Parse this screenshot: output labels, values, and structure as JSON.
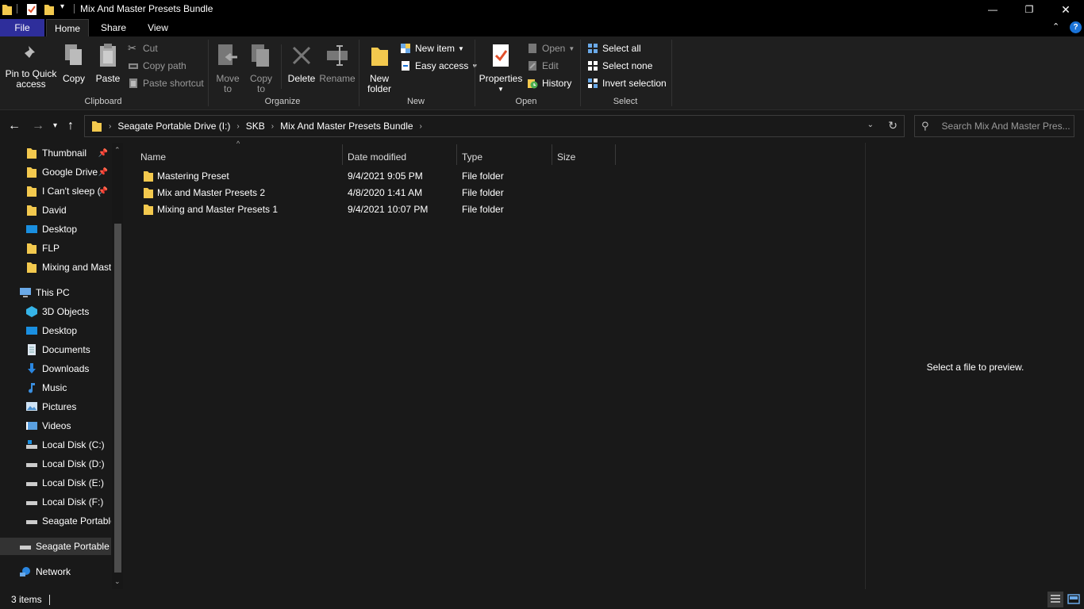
{
  "window": {
    "title": "Mix And Master Presets Bundle",
    "minimize": "—",
    "maximize": "❐",
    "close": "✕"
  },
  "tabs": [
    "File",
    "Home",
    "Share",
    "View"
  ],
  "ribbon": {
    "clipboard": {
      "label": "Clipboard",
      "pin": "Pin to Quick access",
      "pin_l1": "Pin to Quick",
      "pin_l2": "access",
      "copy": "Copy",
      "paste": "Paste",
      "cut": "Cut",
      "copy_path": "Copy path",
      "paste_shortcut": "Paste shortcut"
    },
    "organize": {
      "label": "Organize",
      "move_l1": "Move",
      "move_l2": "to",
      "copy_l1": "Copy",
      "copy_l2": "to",
      "delete": "Delete",
      "rename": "Rename"
    },
    "new": {
      "label": "New",
      "folder_l1": "New",
      "folder_l2": "folder",
      "new_item": "New item",
      "easy_access": "Easy access"
    },
    "open": {
      "label": "Open",
      "properties": "Properties",
      "open": "Open",
      "edit": "Edit",
      "history": "History"
    },
    "select": {
      "label": "Select",
      "select_all": "Select all",
      "select_none": "Select none",
      "invert": "Invert selection"
    }
  },
  "address": {
    "crumbs": [
      "Seagate Portable Drive (I:)",
      "SKB",
      "Mix And Master Presets Bundle"
    ],
    "search_placeholder": "Search Mix And Master Pres..."
  },
  "nav": {
    "quick": [
      "Thumbnail",
      "Google Drive",
      "I Can't sleep (",
      "David",
      "Desktop",
      "FLP",
      "Mixing and Mast"
    ],
    "this_pc": "This PC",
    "pc_items": [
      "3D Objects",
      "Desktop",
      "Documents",
      "Downloads",
      "Music",
      "Pictures",
      "Videos",
      "Local Disk (C:)",
      "Local Disk (D:)",
      "Local Disk (E:)",
      "Local Disk (F:)",
      "Seagate Portable"
    ],
    "drive": "Seagate Portable D",
    "network": "Network"
  },
  "columns": {
    "name": "Name",
    "date": "Date modified",
    "type": "Type",
    "size": "Size"
  },
  "files": [
    {
      "name": "Mastering Preset",
      "date": "9/4/2021 9:05 PM",
      "type": "File folder"
    },
    {
      "name": "Mix and Master Presets 2",
      "date": "4/8/2020 1:41 AM",
      "type": "File folder"
    },
    {
      "name": "Mixing and Master Presets 1",
      "date": "9/4/2021 10:07 PM",
      "type": "File folder"
    }
  ],
  "preview": {
    "message": "Select a file to preview."
  },
  "status": {
    "items": "3 items"
  },
  "colors": {
    "file_tab": "#2e2e9b",
    "folder": "#f3c94e",
    "accent": "#1a73d8"
  }
}
